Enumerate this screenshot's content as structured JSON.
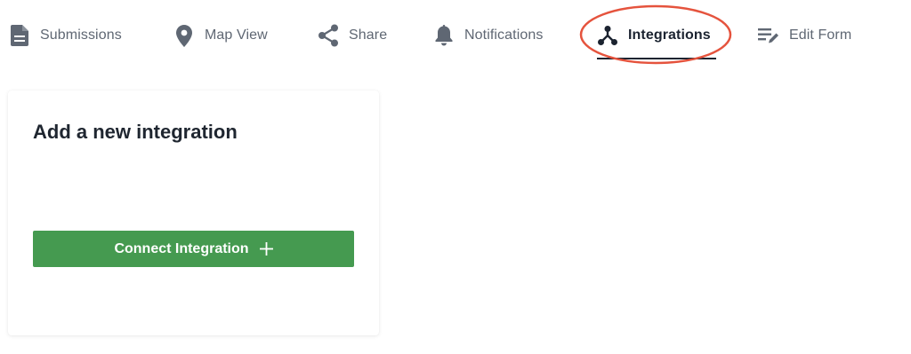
{
  "tabs": {
    "submissions": {
      "label": "Submissions",
      "icon": "document-icon"
    },
    "map_view": {
      "label": "Map View",
      "icon": "map-pin-icon"
    },
    "share": {
      "label": "Share",
      "icon": "share-icon"
    },
    "notifications": {
      "label": "Notifications",
      "icon": "bell-icon"
    },
    "integrations": {
      "label": "Integrations",
      "icon": "integrations-icon",
      "active": true
    },
    "edit_form": {
      "label": "Edit Form",
      "icon": "edit-list-icon"
    }
  },
  "annotation": {
    "highlight": "integrations",
    "color": "#e5533d"
  },
  "card": {
    "title": "Add a new integration",
    "button_label": "Connect Integration",
    "button_icon": "plus-icon",
    "button_color": "#459a50"
  },
  "colors": {
    "tab_text": "#5f6773",
    "tab_active_text": "#1b2330",
    "icon": "#5f6773"
  }
}
